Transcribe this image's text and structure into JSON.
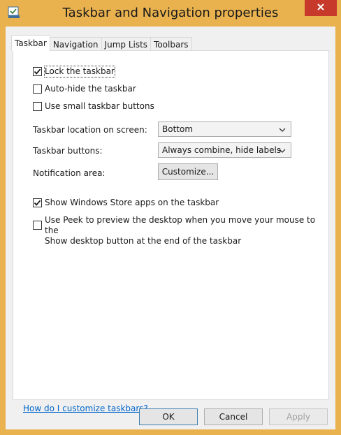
{
  "window": {
    "title": "Taskbar and Navigation properties"
  },
  "tabs": [
    {
      "label": "Taskbar"
    },
    {
      "label": "Navigation"
    },
    {
      "label": "Jump Lists"
    },
    {
      "label": "Toolbars"
    }
  ],
  "options": {
    "lock": {
      "label": "Lock the taskbar",
      "checked": true
    },
    "autohide": {
      "label": "Auto-hide the taskbar",
      "checked": false
    },
    "small": {
      "label": "Use small taskbar buttons",
      "checked": false
    },
    "store": {
      "label": "Show Windows Store apps on the taskbar",
      "checked": true
    },
    "peek": {
      "label_line1": "Use Peek to preview the desktop when you move your mouse to the",
      "label_line2": "Show desktop button at the end of the taskbar",
      "checked": false
    }
  },
  "location": {
    "label": "Taskbar location on screen:",
    "value": "Bottom"
  },
  "buttons_setting": {
    "label": "Taskbar buttons:",
    "value": "Always combine, hide labels"
  },
  "notification": {
    "label": "Notification area:",
    "button": "Customize..."
  },
  "help_link": "How do I customize taskbars?",
  "footer": {
    "ok": "OK",
    "cancel": "Cancel",
    "apply": "Apply"
  }
}
